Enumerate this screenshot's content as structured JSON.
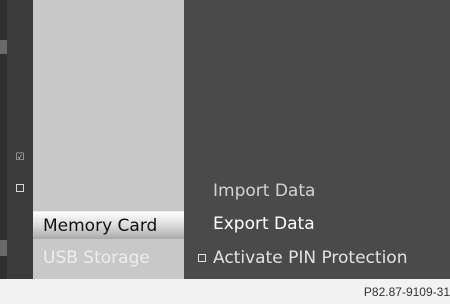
{
  "source_list": {
    "items": [
      {
        "label": "Memory Card",
        "state": "selected"
      },
      {
        "label": "USB Storage",
        "state": "inactive"
      }
    ]
  },
  "menu": {
    "items": [
      {
        "label": "Import Data",
        "state": "dimmed"
      },
      {
        "label": "Export Data",
        "state": "highlighted"
      },
      {
        "label": "Activate PIN Protection",
        "checkbox": "unchecked"
      }
    ]
  },
  "side_icons": {
    "checked": "check-icon",
    "unchecked": "square-icon"
  },
  "figure_code": "P82.87-9109-31",
  "colors": {
    "screen_background": "#4a4a4a",
    "source_panel": "#c8c8c8",
    "highlight_text": "#ffffff"
  }
}
